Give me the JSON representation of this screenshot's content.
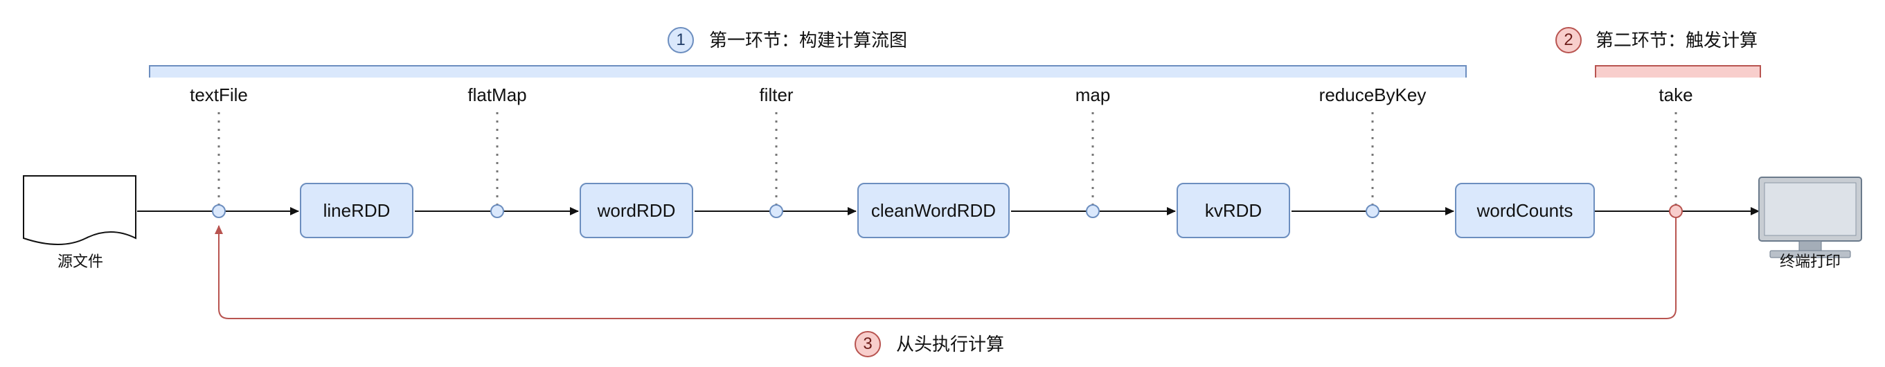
{
  "phases": {
    "phase1": {
      "number": "1",
      "label": "第一环节：构建计算流图"
    },
    "phase2": {
      "number": "2",
      "label": "第二环节：触发计算"
    },
    "phase3": {
      "number": "3",
      "label": "从头执行计算"
    }
  },
  "operators": {
    "textFile": "textFile",
    "flatMap": "flatMap",
    "filter": "filter",
    "map": "map",
    "reduceByKey": "reduceByKey",
    "take": "take"
  },
  "rdds": {
    "lineRDD": "lineRDD",
    "wordRDD": "wordRDD",
    "cleanWordRDD": "cleanWordRDD",
    "kvRDD": "kvRDD",
    "wordCounts": "wordCounts"
  },
  "endpoints": {
    "source": "源文件",
    "terminal": "终端打印"
  },
  "colors": {
    "blue_fill": "#dae8fc",
    "blue_stroke": "#6c8ebf",
    "red_fill": "#f8cecc",
    "red_stroke": "#b85450"
  }
}
